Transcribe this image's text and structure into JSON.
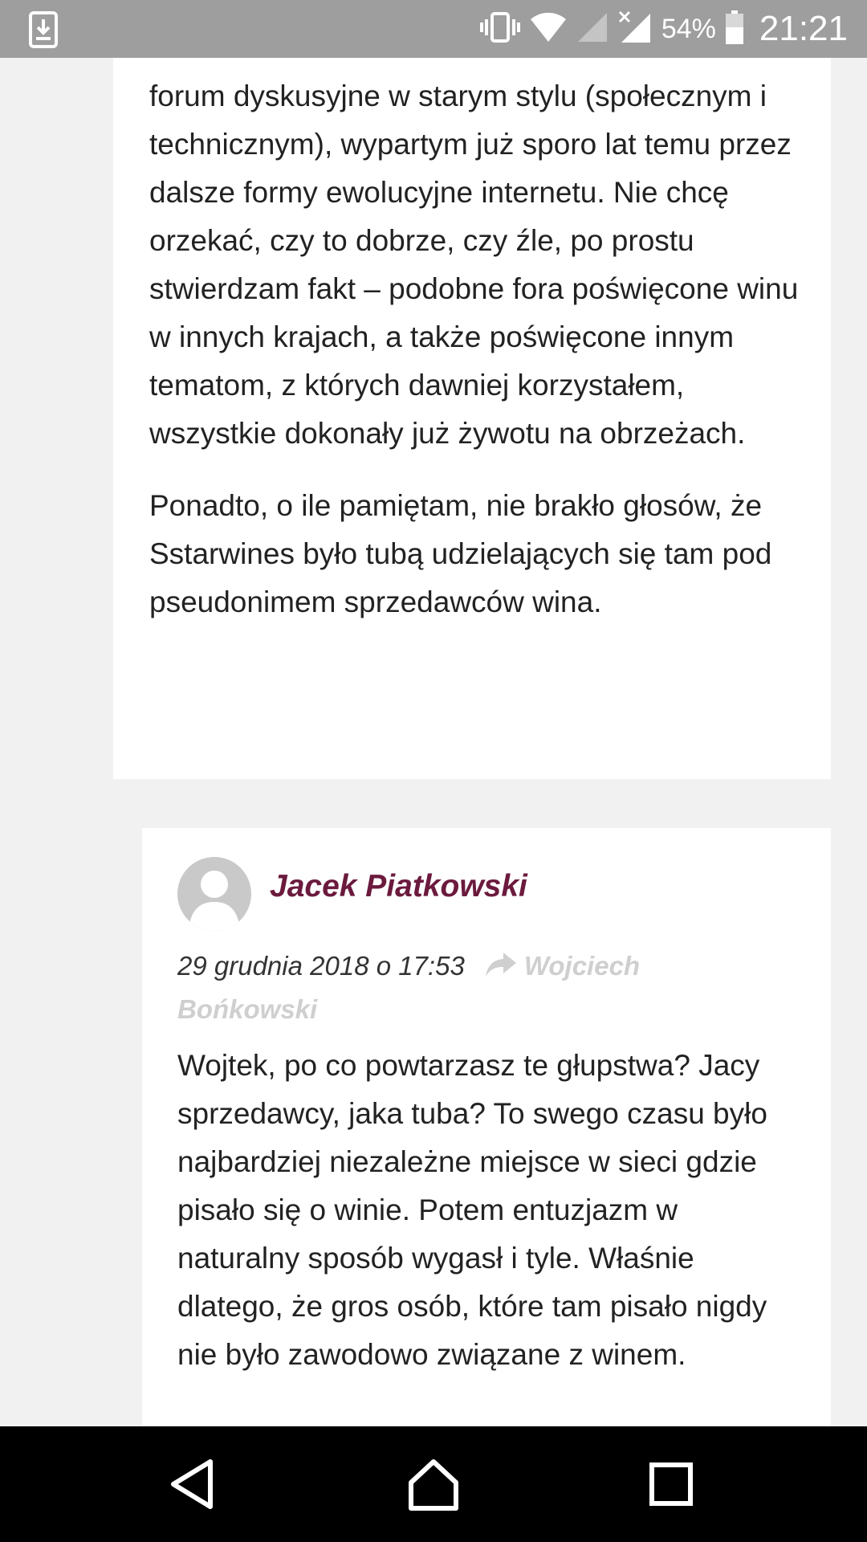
{
  "status_bar": {
    "battery_percent": "54%",
    "time": "21:21",
    "icons": [
      "download-icon",
      "vibrate-icon",
      "wifi-icon",
      "signal-icon",
      "signal-x-icon",
      "battery-icon"
    ]
  },
  "previous_comment": {
    "paragraphs": [
      "forum dyskusyjne w starym stylu (społecznym i technicznym), wypartym już sporo lat temu przez dalsze formy ewolucyjne internetu. Nie chcę orzekać, czy to dobrze, czy źle, po prostu stwierdzam fakt – podobne fora poświęcone winu w innych krajach, a także poświęcone innym tematom, z których dawniej korzystałem, wszystkie dokonały już żywotu na obrzeżach.",
      "Ponadto, o ile pamiętam, nie brakło głosów, że Sstarwines było tubą udzielających się tam pod pseudonimem sprzedawców wina."
    ]
  },
  "reply_comment": {
    "author": "Jacek Piatkowski",
    "date": "29 grudnia 2018 o 17:53",
    "in_reply_to": "Wojciech Bońkowski",
    "paragraphs": [
      "Wojtek, po co powtarzasz te głupstwa? Jacy sprzedawcy, jaka tuba? To swego czasu było najbardziej niezależne miejsce w sieci gdzie pisało się o winie. Potem entuzjazm w naturalny sposób wygasł i tyle. Właśnie dlatego, że gros osób, które tam pisało nigdy nie było zawodowo związane z winem."
    ]
  },
  "nav_bar": {
    "buttons": [
      "back-icon",
      "home-icon",
      "recents-icon"
    ]
  }
}
